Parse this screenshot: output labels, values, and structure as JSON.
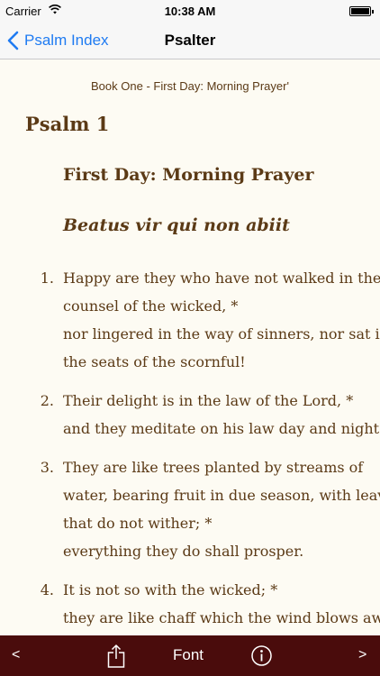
{
  "status_bar": {
    "carrier": "Carrier",
    "time": "10:38 AM",
    "wifi_icon": "wifi-icon",
    "battery_icon": "battery-icon"
  },
  "nav": {
    "back_label": "Psalm Index",
    "title": "Psalter",
    "accent_color": "#1f7bf2"
  },
  "content": {
    "book_heading": "Book One - First Day: Morning Prayer'",
    "psalm_title": "Psalm 1",
    "day_title": "First Day: Morning Prayer",
    "latin_title": "Beatus vir qui non abiit",
    "text_color": "#5b3a16",
    "verses": [
      {
        "number": "1.",
        "lines": [
          "Happy are they who have not walked in the",
          "counsel of the wicked, *",
          "nor lingered in the way of sinners, nor sat in",
          "the seats of the scornful!"
        ]
      },
      {
        "number": "2.",
        "lines": [
          "Their delight is in the law of the Lord, *",
          "and they meditate on his law day and night."
        ]
      },
      {
        "number": "3.",
        "lines": [
          "They are like trees planted by streams of",
          "water, bearing fruit in due season, with leaves",
          "that do not wither; *",
          "everything they do shall prosper."
        ]
      },
      {
        "number": "4.",
        "lines": [
          "It is not so with the wicked; *",
          "they are like chaff which the wind blows away."
        ]
      }
    ]
  },
  "toolbar": {
    "prev_label": "<",
    "share_icon": "share-icon",
    "font_label": "Font",
    "info_icon": "info-icon",
    "next_label": ">",
    "background_color": "#4a0c0c"
  }
}
